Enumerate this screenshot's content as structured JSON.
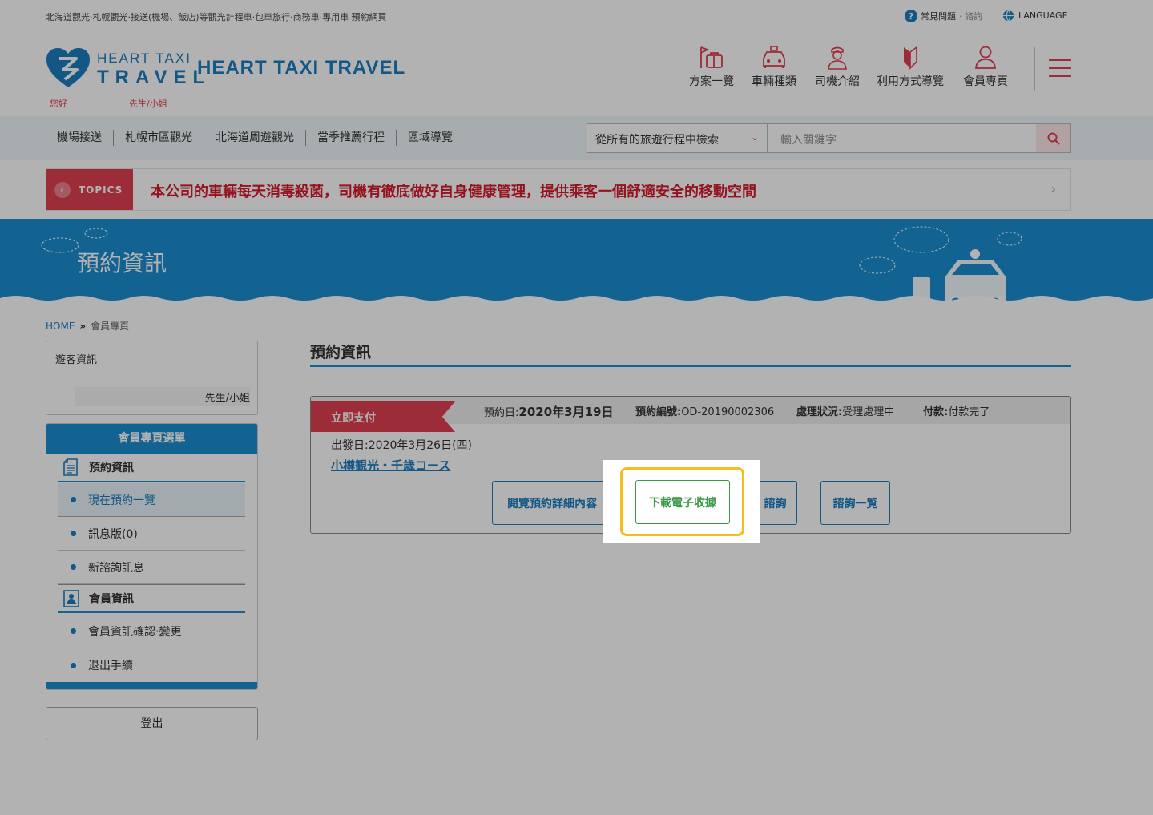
{
  "topbar": {
    "description": "北海道觀光‧札幌觀光‧接送(機場、飯店)等觀光計程車‧包車旅行‧商務車‧專用車 預約網頁",
    "faq_label": "常見問題",
    "faq_sub": "‧ 諮詢",
    "language_label": "LANGUAGE"
  },
  "header": {
    "logo_line1": "HEART TAXI",
    "logo_line2": "TRAVEL",
    "site_name": "HEART TAXI TRAVEL",
    "greeting_hello": "您好",
    "greeting_suffix": "先生/小姐",
    "nav": [
      {
        "label": "方案一覽",
        "icon": "flag-suitcase-icon"
      },
      {
        "label": "車輛種類",
        "icon": "car-icon"
      },
      {
        "label": "司機介紹",
        "icon": "driver-icon"
      },
      {
        "label": "利用方式導覽",
        "icon": "beginner-mark-icon"
      },
      {
        "label": "會員專頁",
        "icon": "user-icon"
      }
    ]
  },
  "categories": [
    "機場接送",
    "札幌市區觀光",
    "北海道周遊觀光",
    "當季推薦行程",
    "區域導覽"
  ],
  "search": {
    "scope": "從所有的旅遊行程中檢索",
    "placeholder": "輸入關鍵字"
  },
  "topics": {
    "tag": "TOPICS",
    "text": "本公司的車輛每天消毒殺菌，司機有徹底做好自身健康管理，提供乘客一個舒適安全的移動空間"
  },
  "banner": {
    "title": "預約資訊"
  },
  "breadcrumb": {
    "home": "HOME",
    "sep": "»",
    "current": "會員專頁"
  },
  "sidebar": {
    "guest_title": "遊客資訊",
    "guest_name_suffix": "先生/小姐",
    "menu_title": "會員專頁選單",
    "sections": [
      {
        "title": "預約資訊",
        "items": [
          "現在預約一覽",
          "訊息版(0)",
          "新諮詢訊息"
        ]
      },
      {
        "title": "會員資訊",
        "items": [
          "會員資訊確認‧變更",
          "退出手續"
        ]
      }
    ],
    "logout": "登出"
  },
  "main": {
    "title": "預約資訊",
    "booking": {
      "pay_tag": "立即支付",
      "date_label": "預約日:",
      "date_value": "2020年3月19日",
      "number_label": "預約編號:",
      "number_value": "OD-20190002306",
      "status_label": "處理狀況:",
      "status_value": "受理處理中",
      "payment_label": "付款:",
      "payment_value": "付款完了",
      "departure": "出發日:2020年3月26日(四)",
      "course": "小樽観光・千歳コース",
      "buttons": {
        "details": "閱覽預約詳細內容",
        "receipt": "下載電子收據",
        "inquiry": "諮詢",
        "inquiry_list": "諮詢一覧"
      }
    }
  },
  "colors": {
    "brand_blue": "#1a8fd1",
    "accent_red": "#e04050",
    "highlight": "#f5bd1e",
    "receipt_green": "#3a9a47"
  }
}
